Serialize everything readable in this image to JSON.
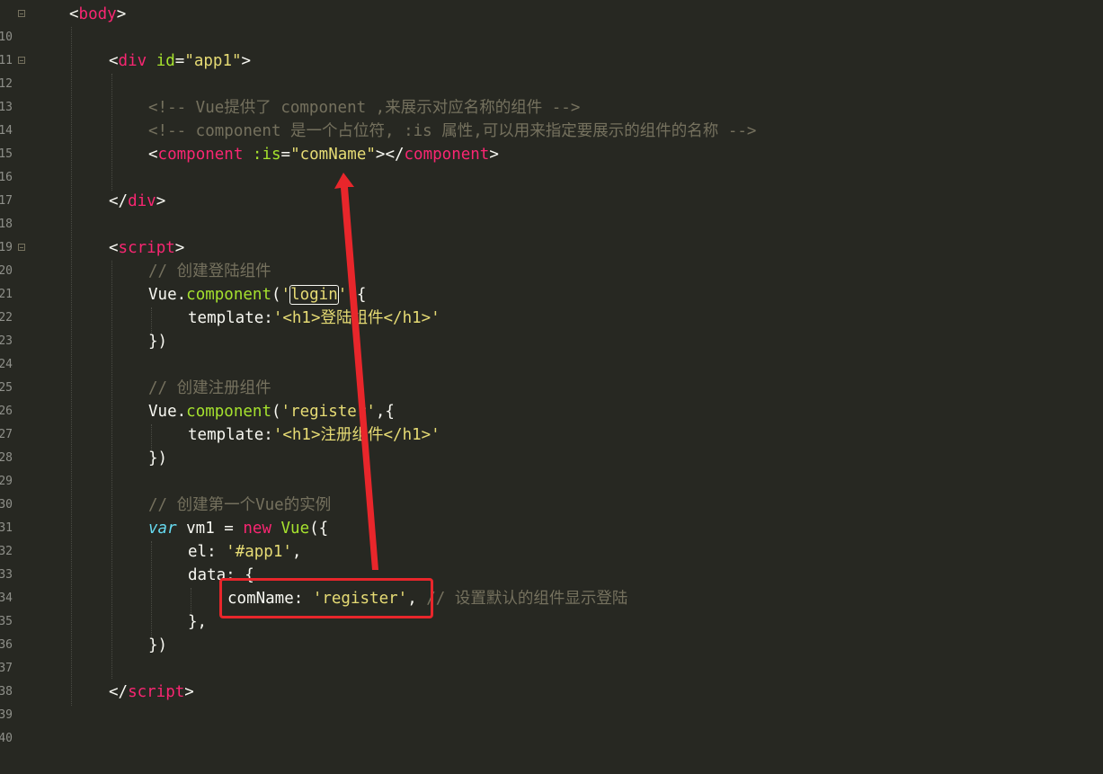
{
  "lines": [
    {
      "n": "10",
      "fold": true
    },
    {
      "n": "11"
    },
    {
      "n": "12",
      "fold": true
    },
    {
      "n": "13"
    },
    {
      "n": "14"
    },
    {
      "n": "15"
    },
    {
      "n": "16"
    },
    {
      "n": "17"
    },
    {
      "n": "18"
    },
    {
      "n": "19"
    },
    {
      "n": "20",
      "fold": true
    },
    {
      "n": "21"
    },
    {
      "n": "22"
    },
    {
      "n": "23"
    },
    {
      "n": "24"
    },
    {
      "n": "25"
    },
    {
      "n": "26"
    },
    {
      "n": "27"
    },
    {
      "n": "28"
    },
    {
      "n": "29"
    },
    {
      "n": "30"
    },
    {
      "n": "31"
    },
    {
      "n": "32"
    },
    {
      "n": "33"
    },
    {
      "n": "34"
    },
    {
      "n": "35"
    },
    {
      "n": "36"
    },
    {
      "n": "37"
    },
    {
      "n": "38"
    },
    {
      "n": "39"
    },
    {
      "n": "40"
    }
  ],
  "code": {
    "l10": {
      "lt": "<",
      "tag": "body",
      "gt": ">"
    },
    "l12": {
      "lt": "<",
      "tag": "div",
      "attr": "id",
      "eq": "=",
      "val": "\"app1\"",
      "gt": ">"
    },
    "l14": {
      "comment": "<!-- Vue提供了 component ,来展示对应名称的组件 -->"
    },
    "l15": {
      "comment": "<!-- component 是一个占位符, :is 属性,可以用来指定要展示的组件的名称 -->"
    },
    "l16": {
      "lt": "<",
      "tag": "component",
      "attr": ":is",
      "eq": "=",
      "val": "\"comName\"",
      "mid": "></",
      "tag2": "component",
      "gt": ">"
    },
    "l18": {
      "lt": "</",
      "tag": "div",
      "gt": ">"
    },
    "l20": {
      "lt": "<",
      "tag": "script",
      "gt": ">"
    },
    "l21": {
      "comment": "// 创建登陆组件"
    },
    "l22": {
      "obj": "Vue.",
      "fn": "component",
      "open": "(",
      "q1": "'",
      "name": "login",
      "q2": "'",
      "rest": ",{"
    },
    "l23": {
      "key": "template:",
      "str": "'<h1>登陆组件</h1>'"
    },
    "l24": {
      "text": "})"
    },
    "l26": {
      "comment": "// 创建注册组件"
    },
    "l27": {
      "obj": "Vue.",
      "fn": "component",
      "open": "(",
      "str": "'register'",
      "rest": ",{"
    },
    "l28": {
      "key": "template:",
      "str": "'<h1>注册组件</h1>'"
    },
    "l29": {
      "text": "})"
    },
    "l31": {
      "comment": "// 创建第一个Vue的实例"
    },
    "l32": {
      "var": "var",
      "name": " vm1 = ",
      "new": "new",
      "fn": " Vue",
      "rest": "({"
    },
    "l33": {
      "key": "el: ",
      "str": "'#app1'",
      "rest": ","
    },
    "l34": {
      "text": "data: {"
    },
    "l35": {
      "key": "comName: ",
      "str": "'register'",
      "rest": ", ",
      "comment": "// 设置默认的组件显示登陆"
    },
    "l36": {
      "text": "},"
    },
    "l37": {
      "text": "})"
    },
    "l39": {
      "lt": "</",
      "tag": "script",
      "gt": ">"
    }
  },
  "annotation": {
    "color": "#e8262b"
  }
}
